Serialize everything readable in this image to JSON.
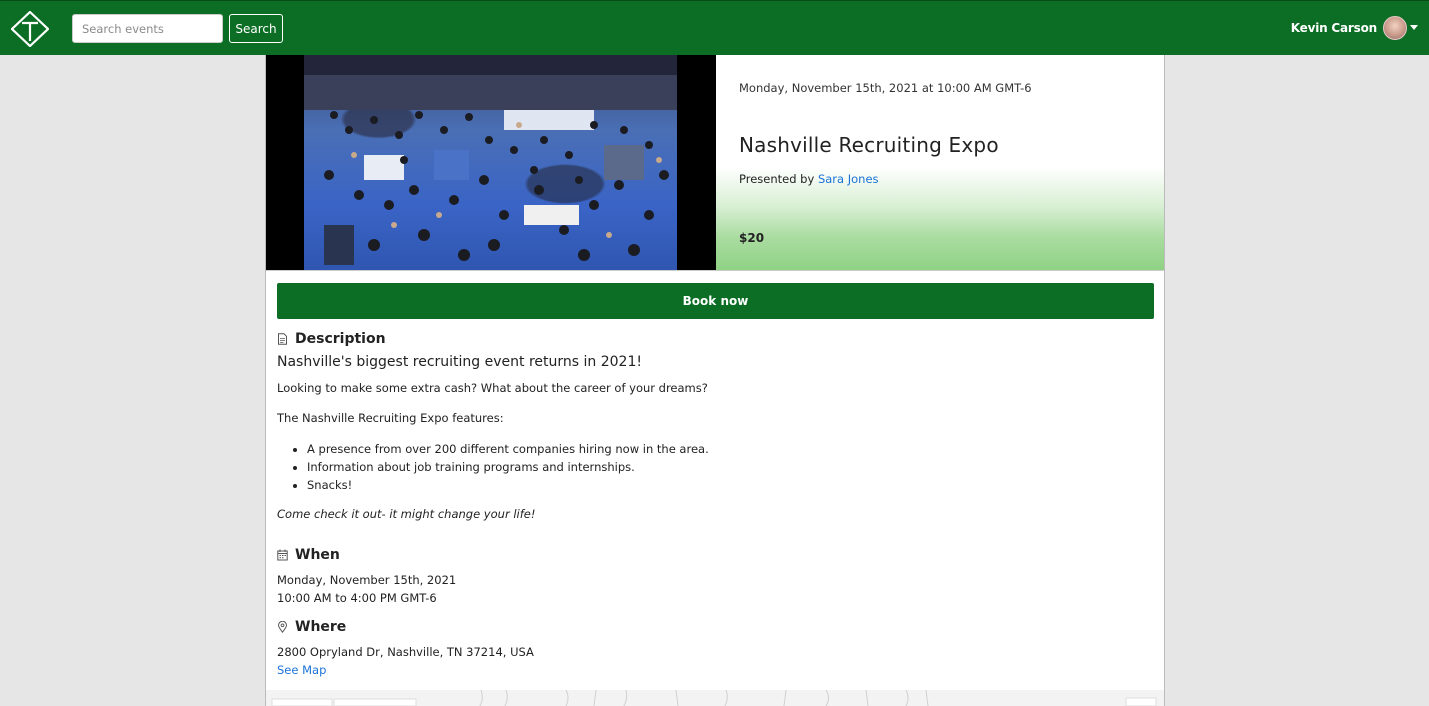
{
  "navbar": {
    "search_placeholder": "Search events",
    "search_label": "Search",
    "user_name": "Kevin Carson"
  },
  "event": {
    "date_header": "Monday, November 15th, 2021 at 10:00 AM GMT-6",
    "title": "Nashville Recruiting Expo",
    "presented_prefix": "Presented by",
    "presenter": "Sara Jones",
    "price": "$20",
    "book_label": "Book now"
  },
  "description": {
    "heading": "Description",
    "lead": "Nashville's biggest recruiting event returns in 2021!",
    "intro": "Looking to make some extra cash? What about the career of your dreams?",
    "features_intro": "The Nashville Recruiting Expo features:",
    "features": [
      "A presence from over 200 different companies hiring now in the area.",
      "Information about job training programs and internships.",
      "Snacks!"
    ],
    "closing": "Come check it out- it might change your life!"
  },
  "when": {
    "heading": "When",
    "date": "Monday, November 15th, 2021",
    "time": "10:00 AM to 4:00 PM GMT-6"
  },
  "where": {
    "heading": "Where",
    "address": "2800 Opryland Dr, Nashville, TN 37214, USA",
    "map_link": "See Map"
  },
  "colors": {
    "brand": "#0b6e24",
    "link": "#1a73d9"
  },
  "icons": [
    "logo-icon",
    "document-icon",
    "calendar-icon",
    "map-pin-icon",
    "caret-down-icon"
  ]
}
